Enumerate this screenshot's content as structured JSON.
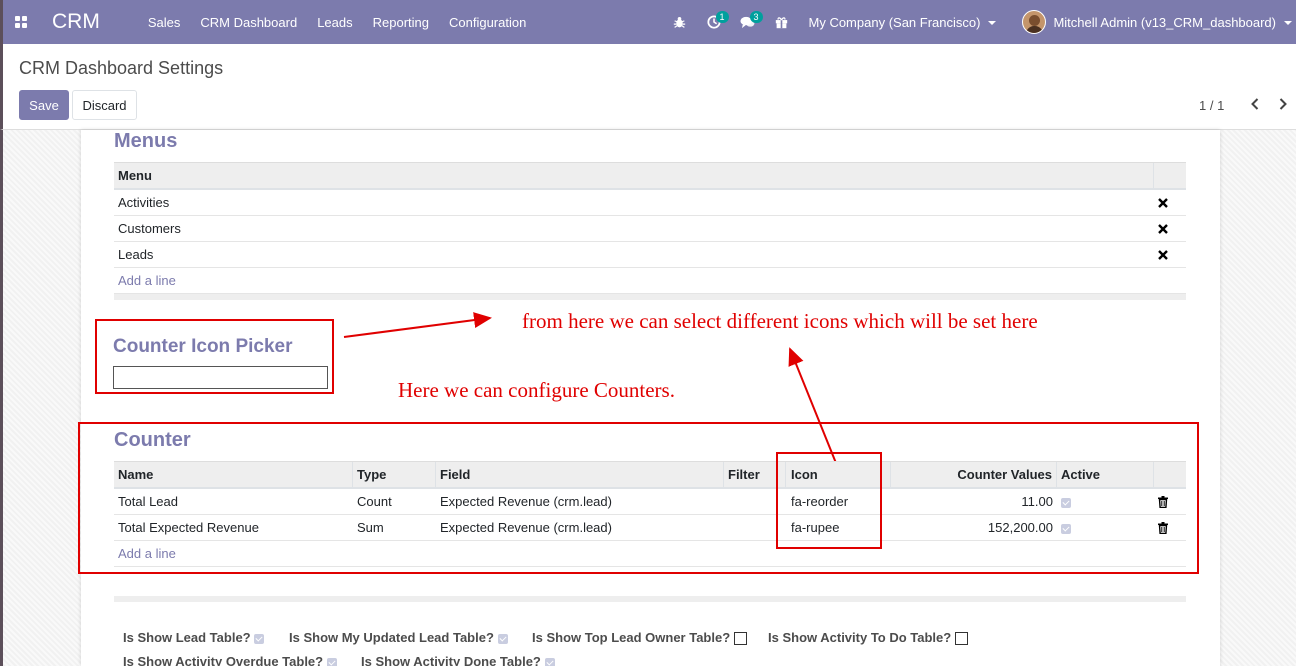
{
  "navbar": {
    "brand": "CRM",
    "menus": [
      "Sales",
      "CRM Dashboard",
      "Leads",
      "Reporting",
      "Configuration"
    ],
    "activity_count": "1",
    "message_count": "3",
    "company": "My Company (San Francisco)",
    "user": "Mitchell Admin (v13_CRM_dashboard)"
  },
  "control": {
    "breadcrumb": "CRM Dashboard Settings",
    "save_label": "Save",
    "discard_label": "Discard",
    "pager": "1 / 1"
  },
  "menus_section": {
    "title": "Menus",
    "column": "Menu",
    "rows": [
      "Activities",
      "Customers",
      "Leads"
    ],
    "add_line": "Add a line"
  },
  "icon_picker": {
    "label": "Counter Icon Picker",
    "value": ""
  },
  "counter_section": {
    "title": "Counter",
    "columns": [
      "Name",
      "Type",
      "Field",
      "Filter",
      "Icon",
      "Counter Values",
      "Active"
    ],
    "rows": [
      {
        "name": "Total Lead",
        "type": "Count",
        "field": "Expected Revenue (crm.lead)",
        "filter": "",
        "icon": "fa-reorder",
        "value": "11.00",
        "active": true
      },
      {
        "name": "Total Expected Revenue",
        "type": "Sum",
        "field": "Expected Revenue (crm.lead)",
        "filter": "",
        "icon": "fa-rupee",
        "value": "152,200.00",
        "active": true
      }
    ],
    "add_line": "Add a line"
  },
  "options": [
    {
      "label": "Is Show Lead Table?",
      "checked": true
    },
    {
      "label": "Is Show My Updated Lead Table?",
      "checked": true
    },
    {
      "label": "Is Show Top Lead Owner Table?",
      "checked": false
    },
    {
      "label": "Is Show Activity To Do Table?",
      "checked": false
    },
    {
      "label": "Is Show Activity Overdue Table?",
      "checked": true
    },
    {
      "label": "Is Show Activity Done Table?",
      "checked": true
    }
  ],
  "annotations": {
    "icons_note": "from here we can select different icons which will be set here",
    "counters_note": "Here we can configure Counters.",
    "color": "#e00000"
  },
  "colors": {
    "brand": "#7c7bad",
    "badge": "#00a09d"
  }
}
